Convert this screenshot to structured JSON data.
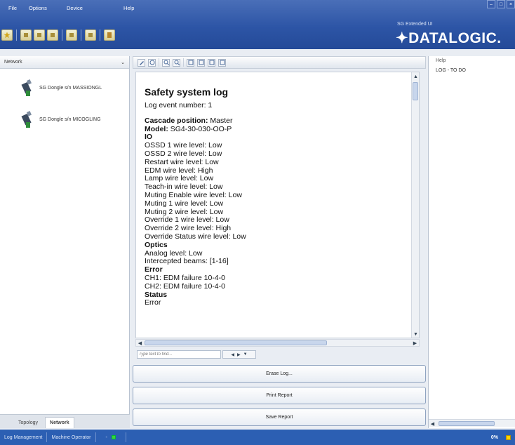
{
  "menu": [
    "File",
    "Options",
    "Device",
    "Help"
  ],
  "app": {
    "subtitle": "SG Extended UI",
    "brand": "✦DATALOGIC."
  },
  "left": {
    "header": "Network",
    "devices": [
      {
        "label": "SG Dongle s/n MASSIONGL"
      },
      {
        "label": "SG Dongle s/n MICOGLING"
      }
    ],
    "tabs": [
      "Topology",
      "Network"
    ]
  },
  "log": {
    "title": "Safety system log",
    "lines": [
      {
        "t": "Log event number: 1",
        "kind": "line"
      },
      {
        "t": "",
        "kind": "gap"
      },
      {
        "k": "Cascade position:",
        "v": " Master",
        "kind": "kv"
      },
      {
        "k": "Model:",
        "v": " SG4-30-030-OO-P",
        "kind": "kv"
      },
      {
        "t": "IO",
        "kind": "head"
      },
      {
        "t": "OSSD 1 wire level: Low",
        "kind": "line"
      },
      {
        "t": "OSSD 2 wire level: Low",
        "kind": "line"
      },
      {
        "t": "Restart wire level: Low",
        "kind": "line"
      },
      {
        "t": "EDM wire level: High",
        "kind": "line"
      },
      {
        "t": "Lamp wire level: Low",
        "kind": "line"
      },
      {
        "t": "Teach-in wire level: Low",
        "kind": "line"
      },
      {
        "t": "Muting Enable wire level: Low",
        "kind": "line"
      },
      {
        "t": "Muting 1 wire level: Low",
        "kind": "line"
      },
      {
        "t": "Muting 2 wire level: Low",
        "kind": "line"
      },
      {
        "t": "Override 1 wire level: Low",
        "kind": "line"
      },
      {
        "t": "Override 2 wire level: High",
        "kind": "line"
      },
      {
        "t": "Override Status wire level: Low",
        "kind": "line"
      },
      {
        "t": "Optics",
        "kind": "head"
      },
      {
        "t": "Analog level: Low",
        "kind": "line"
      },
      {
        "t": "Intercepted beams: [1-16]",
        "kind": "line"
      },
      {
        "t": "Error",
        "kind": "head"
      },
      {
        "t": "CH1: EDM failure 10-4-0",
        "kind": "line"
      },
      {
        "t": "CH2: EDM failure 10-4-0",
        "kind": "line"
      },
      {
        "t": "Status",
        "kind": "head"
      },
      {
        "t": "Error",
        "kind": "line"
      }
    ]
  },
  "find": {
    "placeholder": "Type text to find..."
  },
  "actions": {
    "erase": "Erase Log...",
    "print": "Print Report",
    "save": "Save Report"
  },
  "help": {
    "header": "Help",
    "text": "LOG - TO DO"
  },
  "status": {
    "items": [
      "Log Management",
      "Machine Operator"
    ],
    "percent": "0%"
  },
  "colors": {
    "topbar": "#2d55a6",
    "statusbar": "#2c5fb3",
    "led_green": "#3ad23a",
    "led_yellow": "#ffd400"
  }
}
